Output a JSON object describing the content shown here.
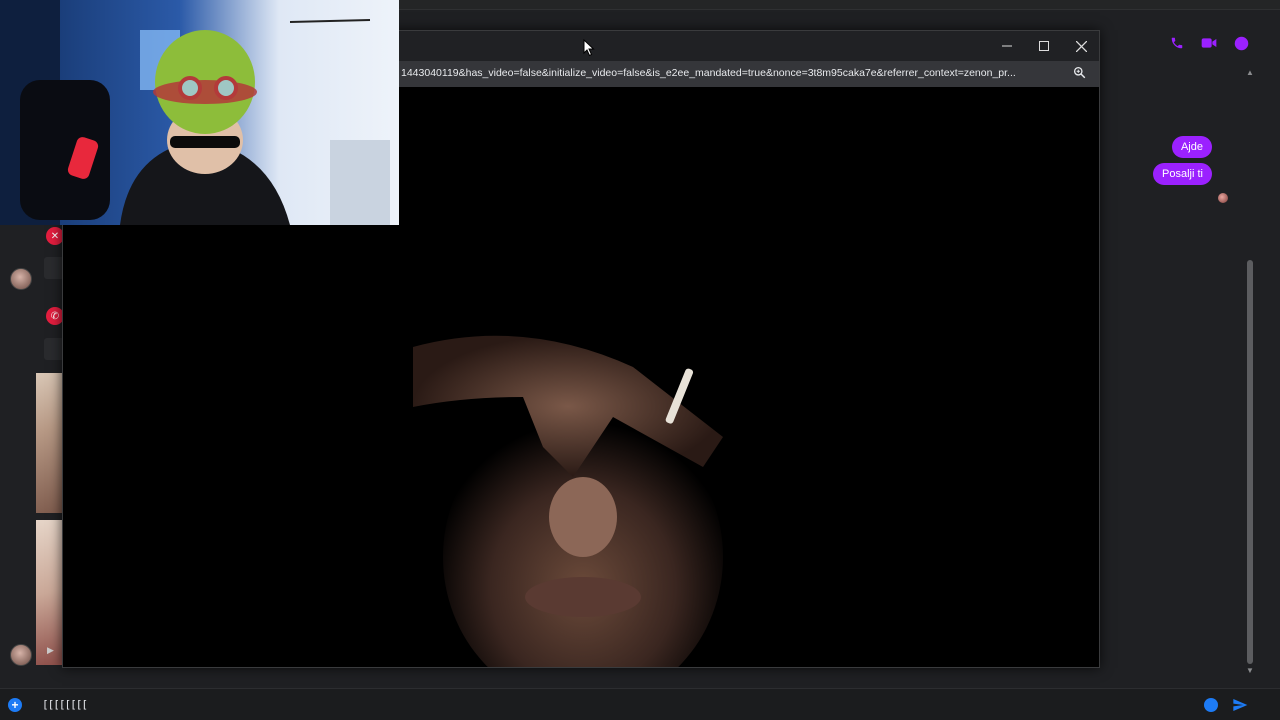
{
  "messenger": {
    "messages": [
      {
        "text": "Ajde"
      },
      {
        "text": "Posalji ti"
      }
    ],
    "composer": {
      "value": "[[[[[[[["
    },
    "colors": {
      "accent": "#9b21ff",
      "icon_blue": "#1d7bf5",
      "call_red": "#e41e3f"
    },
    "header_icons": [
      "phone-icon",
      "video-camera-icon",
      "info-icon"
    ]
  },
  "popup": {
    "url": "1443040119&has_video=false&initialize_video=false&is_e2ee_mandated=true&nonce=3t8m95caka7e&referrer_context=zenon_pr...",
    "controls": [
      "minimize-icon",
      "maximize-icon",
      "close-icon"
    ]
  }
}
